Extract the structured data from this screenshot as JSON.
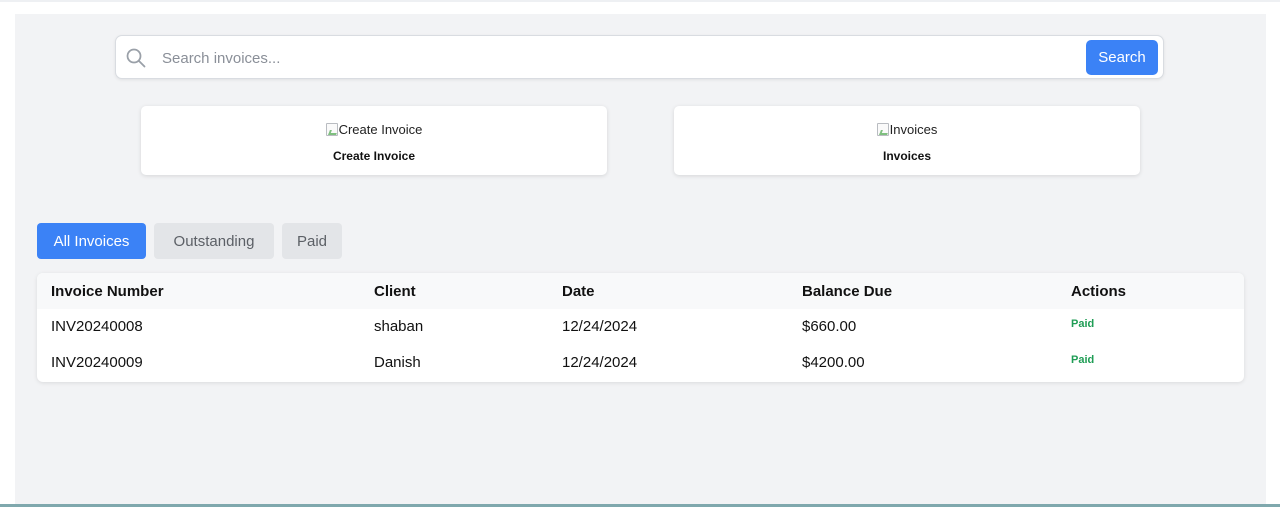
{
  "search": {
    "placeholder": "Search invoices...",
    "button_label": "Search"
  },
  "cards": [
    {
      "image_alt": "Create Invoice",
      "label": "Create Invoice"
    },
    {
      "image_alt": "Invoices",
      "label": "Invoices"
    }
  ],
  "tabs": [
    {
      "label": "All Invoices",
      "active": true
    },
    {
      "label": "Outstanding",
      "active": false
    },
    {
      "label": "Paid",
      "active": false
    }
  ],
  "table": {
    "headers": [
      "Invoice Number",
      "Client",
      "Date",
      "Balance Due",
      "Actions"
    ],
    "rows": [
      {
        "invoice_number": "INV20240008",
        "client": "shaban",
        "date": "12/24/2024",
        "balance_due": "$660.00",
        "action": "Paid"
      },
      {
        "invoice_number": "INV20240009",
        "client": "Danish",
        "date": "12/24/2024",
        "balance_due": "$4200.00",
        "action": "Paid"
      }
    ]
  },
  "colors": {
    "accent": "#3b82f6",
    "paid_status": "#1f9d55",
    "panel_background": "#f2f3f5"
  }
}
